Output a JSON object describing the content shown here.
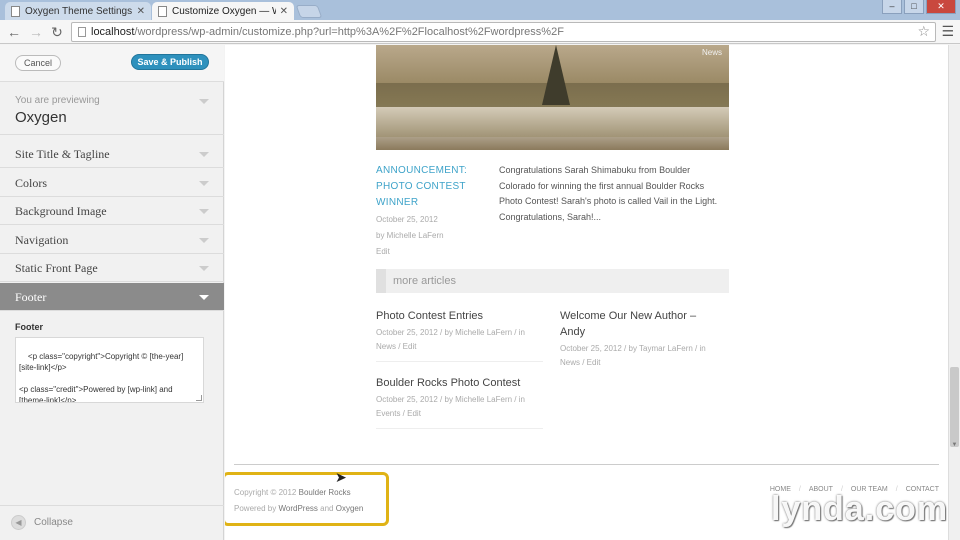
{
  "browser": {
    "tabs": [
      {
        "title": "Oxygen Theme Settings « B",
        "active": false
      },
      {
        "title": "Customize Oxygen — Wor",
        "active": true
      }
    ],
    "address": {
      "host": "localhost",
      "path": "/wordpress/wp-admin/customize.php?url=http%3A%2F%2Flocalhost%2Fwordpress%2F"
    }
  },
  "sidebar": {
    "cancel_label": "Cancel",
    "save_label": "Save & Publish",
    "previewing_label": "You are previewing",
    "theme_name": "Oxygen",
    "sections": [
      {
        "label": "Site Title & Tagline"
      },
      {
        "label": "Colors"
      },
      {
        "label": "Background Image"
      },
      {
        "label": "Navigation"
      },
      {
        "label": "Static Front Page"
      },
      {
        "label": "Footer",
        "active": true
      }
    ],
    "footer_field_label": "Footer",
    "footer_textarea": "<p class=\"copyright\">Copyright © [the-year] [site-link]</p>\n\n<p class=\"credit\">Powered by [wp-link] and [theme-link]</p>",
    "collapse_label": "Collapse"
  },
  "preview": {
    "hero_badge": "News",
    "announcement": {
      "title": "ANNOUNCEMENT: PHOTO CONTEST WINNER",
      "date": "October 25, 2012",
      "author": "by Michelle LaFern",
      "edit": "Edit",
      "excerpt": "Congratulations Sarah Shimabuku from Boulder Colorado for winning the first annual Boulder Rocks Photo Contest! Sarah's photo is called Vail in the Light. Congratulations, Sarah!..."
    },
    "more_articles_label": "more articles",
    "posts": [
      {
        "title": "Photo Contest Entries",
        "meta1": "October 25, 2012 / by Michelle LaFern / in",
        "meta2": "News / Edit"
      },
      {
        "title": "Welcome Our New Author – Andy",
        "meta1": "October 25, 2012 / by Taymar LaFern / in",
        "meta2": "News / Edit"
      },
      {
        "title": "Boulder Rocks Photo Contest",
        "meta1": "October 25, 2012 / by Michelle LaFern / in",
        "meta2": "Events / Edit"
      }
    ],
    "footer": {
      "copyright_prefix": "Copyright © 2012",
      "site_link": "Boulder Rocks",
      "powered_prefix": "Powered by",
      "wp_link": "WordPress",
      "and": "and",
      "theme_link": "Oxygen",
      "nav": [
        "HOME",
        "ABOUT",
        "OUR TEAM",
        "CONTACT"
      ]
    }
  },
  "watermark": "lynda.com",
  "colors": {
    "accent": "#2e91bd",
    "highlight": "#e0b316",
    "link_blue": "#3ea3c9"
  }
}
